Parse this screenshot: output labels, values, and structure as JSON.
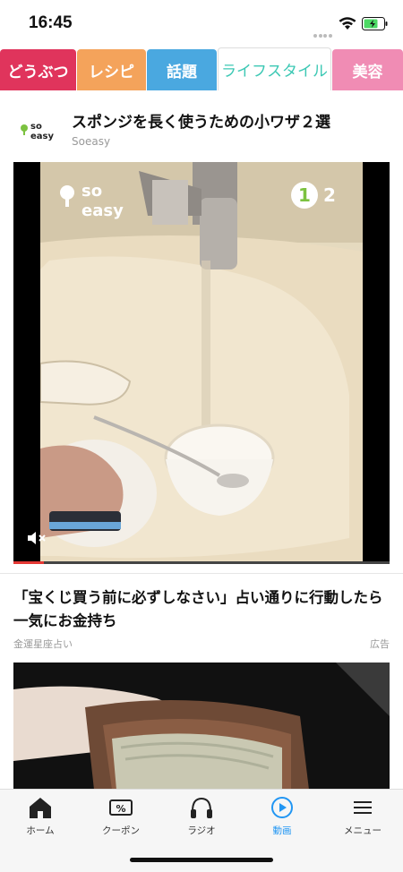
{
  "status_bar": {
    "time": "16:45"
  },
  "tabs": [
    {
      "label": "どうぶつ",
      "color": "#e0345c",
      "active": false
    },
    {
      "label": "レシピ",
      "color": "#f4a35b",
      "active": false
    },
    {
      "label": "話題",
      "color": "#4aa8e0",
      "active": false
    },
    {
      "label": "ライフスタイル",
      "color": "#3cc8b4",
      "active": true
    },
    {
      "label": "美容",
      "color": "#f08cb4",
      "active": false
    }
  ],
  "article": {
    "logo_text": "so easy",
    "title": "スポンジを長く使うための小ワザ２選",
    "source": "Soeasy"
  },
  "video": {
    "logo_text": "so easy",
    "step_current": "1",
    "step_next": "2",
    "muted_icon": "speaker-muted-icon",
    "progress": 0.08
  },
  "ad": {
    "title": "「宝くじ買う前に必ずしなさい」占い通りに行動したら一気にお金持ち",
    "source": "金運星座占い",
    "label": "広告"
  },
  "bottom_nav": [
    {
      "label": "ホーム",
      "icon": "home-icon",
      "active": false
    },
    {
      "label": "クーポン",
      "icon": "coupon-icon",
      "active": false
    },
    {
      "label": "ラジオ",
      "icon": "headphones-icon",
      "active": false
    },
    {
      "label": "動画",
      "icon": "play-icon",
      "active": true
    },
    {
      "label": "メニュー",
      "icon": "menu-icon",
      "active": false
    }
  ],
  "colors": {
    "accent": "#2196f3",
    "progress": "#e53935"
  }
}
